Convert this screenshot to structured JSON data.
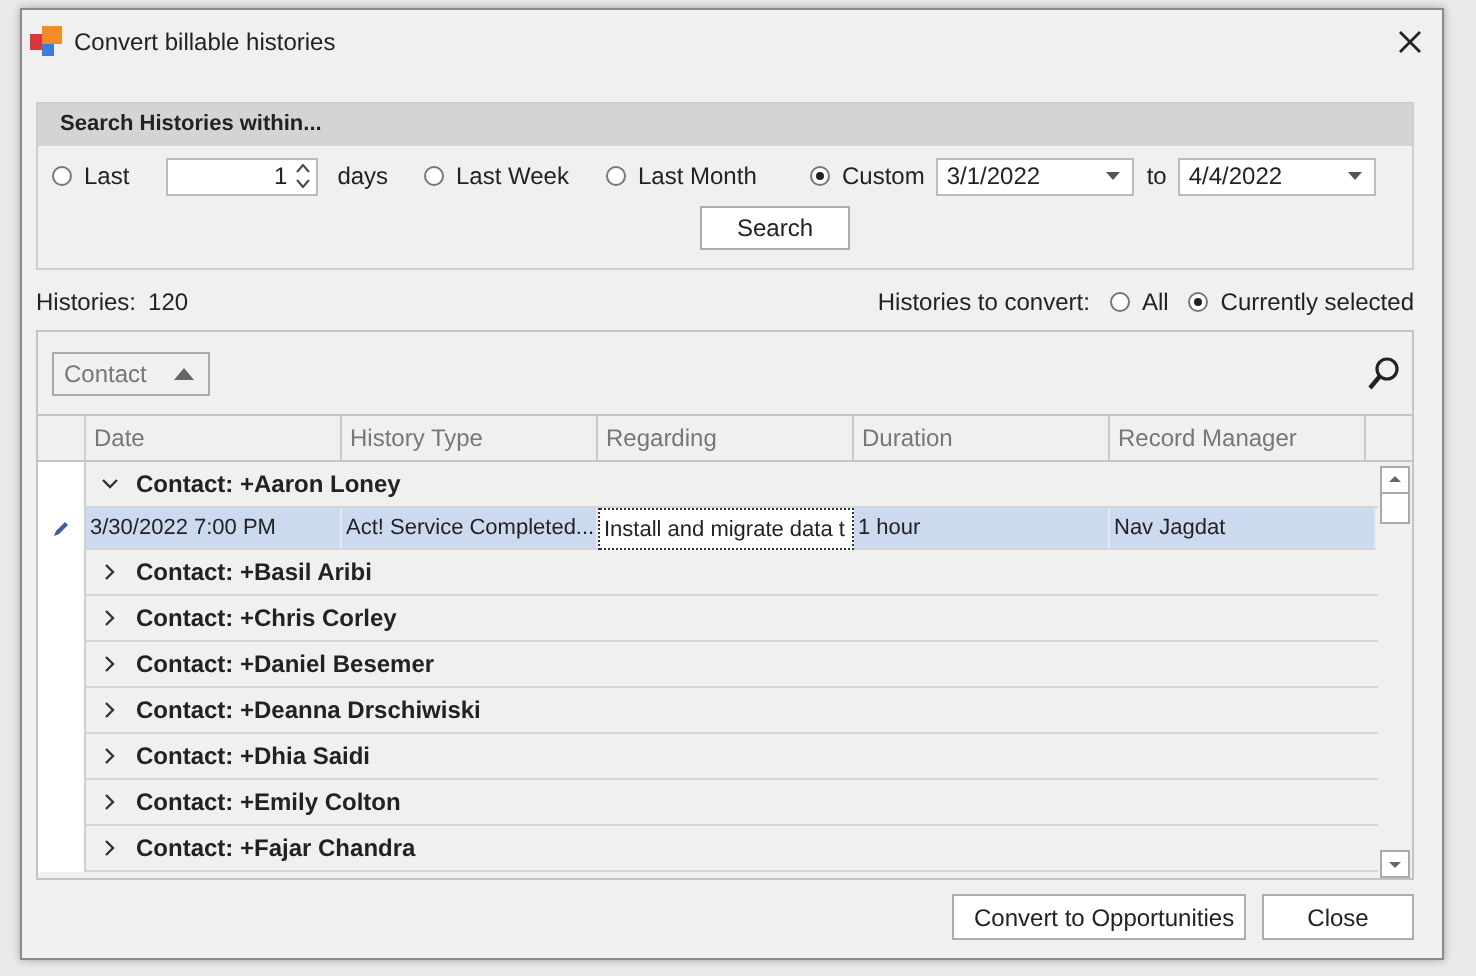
{
  "window": {
    "title": "Convert billable histories"
  },
  "search_group": {
    "title": "Search Histories within...",
    "options": [
      {
        "kind": "days",
        "label": "Last",
        "selected": false,
        "value": "1",
        "unit": "days"
      },
      {
        "kind": "plain",
        "label": "Last Week",
        "selected": false
      },
      {
        "kind": "plain",
        "label": "Last Month",
        "selected": false
      },
      {
        "kind": "range",
        "label": "Custom",
        "selected": true,
        "from": "3/1/2022",
        "to_label": "to",
        "to": "4/4/2022"
      }
    ],
    "button": "Search"
  },
  "summary": {
    "label": "Histories:",
    "count": "120",
    "convert_label": "Histories to convert:",
    "convert_options": [
      {
        "label": "All",
        "selected": false
      },
      {
        "label": "Currently selected",
        "selected": true
      }
    ]
  },
  "grid": {
    "group_by": [
      {
        "label": "Contact"
      }
    ],
    "columns": [
      "Date",
      "History Type",
      "Regarding",
      "Duration",
      "Record Manager"
    ],
    "groups": [
      {
        "label": "Contact: +Aaron Loney",
        "expanded": true,
        "rows": [
          {
            "selected": true,
            "editing": true,
            "cells": [
              {
                "text": "3/30/2022 7:00 PM",
                "focused": false
              },
              {
                "text": "Act! Service Completed...",
                "focused": false
              },
              {
                "text": "Install and migrate data t",
                "focused": true
              },
              {
                "text": "1 hour",
                "focused": false
              },
              {
                "text": "Nav Jagdat",
                "focused": false
              }
            ]
          }
        ]
      },
      {
        "label": "Contact: +Basil Aribi",
        "expanded": false
      },
      {
        "label": "Contact: +Chris Corley",
        "expanded": false
      },
      {
        "label": "Contact: +Daniel Besemer",
        "expanded": false
      },
      {
        "label": "Contact: +Deanna Drschiwiski",
        "expanded": false
      },
      {
        "label": "Contact: +Dhia Saidi",
        "expanded": false
      },
      {
        "label": "Contact: +Emily Colton",
        "expanded": false
      },
      {
        "label": "Contact: +Fajar Chandra",
        "expanded": false
      }
    ]
  },
  "buttons": [
    "Convert to Opportunities",
    "Close"
  ]
}
